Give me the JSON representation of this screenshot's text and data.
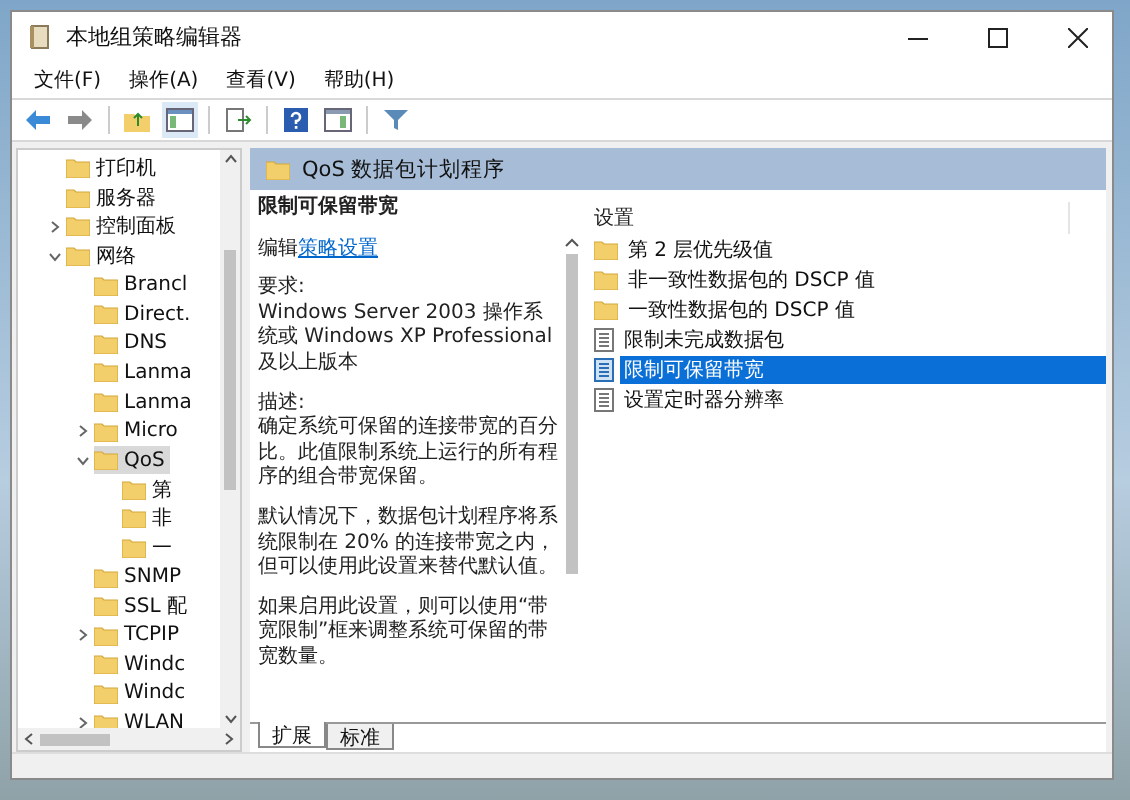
{
  "window": {
    "title": "本地组策略编辑器"
  },
  "menu": [
    "文件(F)",
    "操作(A)",
    "查看(V)",
    "帮助(H)"
  ],
  "tree": [
    {
      "label": "打印机",
      "selected": false
    },
    {
      "label": "服务器",
      "selected": false
    },
    {
      "label": "控制面板",
      "selected": false,
      "expanded": false
    },
    {
      "label": "网络",
      "selected": false,
      "expanded": true,
      "children": [
        {
          "label": "Brancl",
          "selected": false
        },
        {
          "label": "Direct.",
          "selected": false
        },
        {
          "label": "DNS",
          "selected": false
        },
        {
          "label": "Lanma",
          "selected": false
        },
        {
          "label": "Lanma",
          "selected": false
        },
        {
          "label": "Micro",
          "selected": false,
          "expanded": false
        },
        {
          "label": "QoS",
          "selected": true,
          "expanded": true,
          "children": [
            {
              "label": "第",
              "selected": false
            },
            {
              "label": "非",
              "selected": false
            },
            {
              "label": "一",
              "selected": false
            }
          ]
        },
        {
          "label": "SNMP",
          "selected": false
        },
        {
          "label": "SSL 配",
          "selected": false
        },
        {
          "label": "TCPIP",
          "selected": false,
          "expanded": false
        },
        {
          "label": "Windc",
          "selected": false
        },
        {
          "label": "Windc",
          "selected": false
        },
        {
          "label": "WLAN",
          "selected": false,
          "expanded": false
        }
      ]
    }
  ],
  "header": {
    "title": "QoS 数据包计划程序"
  },
  "description": {
    "title": "限制可保留带宽",
    "edit_prefix": "编辑",
    "edit_link": "策略设置",
    "sections": [
      {
        "heading": "要求:",
        "body": "Windows Server 2003 操作系统或 Windows XP Professional 及以上版本"
      },
      {
        "heading": "描述:",
        "body": "确定系统可保留的连接带宽的百分比。此值限制系统上运行的所有程序的组合带宽保留。"
      },
      {
        "body": "默认情况下，数据包计划程序将系统限制在 20% 的连接带宽之内，但可以使用此设置来替代默认值。"
      },
      {
        "body": "如果启用此设置，则可以使用“带宽限制”框来调整系统可保留的带宽数量。"
      }
    ]
  },
  "settings": {
    "column": "设置",
    "rows": [
      {
        "kind": "folder",
        "label": "第 2 层优先级值",
        "selected": false
      },
      {
        "kind": "folder",
        "label": "非一致性数据包的 DSCP 值",
        "selected": false
      },
      {
        "kind": "folder",
        "label": "一致性数据包的 DSCP 值",
        "selected": false
      },
      {
        "kind": "policy",
        "label": "限制未完成数据包",
        "selected": false
      },
      {
        "kind": "policy",
        "label": "限制可保留带宽",
        "selected": true
      },
      {
        "kind": "policy",
        "label": "设置定时器分辨率",
        "selected": false
      }
    ]
  },
  "tabs": [
    {
      "label": "扩展",
      "selected": true
    },
    {
      "label": "标准",
      "selected": false
    }
  ]
}
